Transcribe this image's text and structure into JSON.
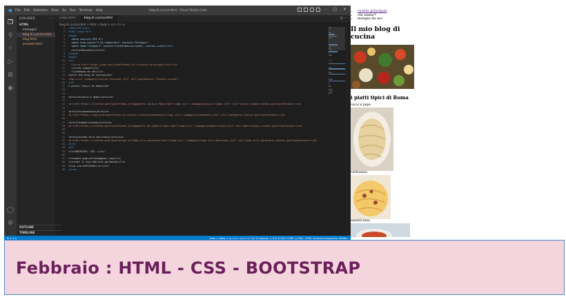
{
  "vscode": {
    "menu": [
      "File",
      "Edit",
      "Selection",
      "View",
      "Go",
      "Run",
      "Terminal",
      "Help"
    ],
    "window_title": "blog di cucina.html - Visual Studio Code",
    "explorer": {
      "header": "EXPLORER",
      "section": "HTML",
      "files": [
        "immagini",
        "blog di cucina.html",
        "blog.html",
        "prodotti.html"
      ],
      "outline": "OUTLINE",
      "timeline": "TIMELINE"
    },
    "tabs": [
      "index.html",
      "blog di cucina.html"
    ],
    "breadcrumb": "blog di cucina.html > html > body > ul > li > a",
    "lines": [
      {
        "n": "1",
        "t": "<!DOCTYPE html>",
        "c": "t"
      },
      {
        "n": "2",
        "t": "<html lang=\"en\">",
        "c": "t"
      },
      {
        "n": "3",
        "t": "<head>",
        "c": "t"
      },
      {
        "n": "4",
        "t": "  <meta charset=\"UTF-8\">",
        "c": "k"
      },
      {
        "n": "5",
        "t": "  <meta http-equiv=\"X-UA-Compatible\" content=\"IE=edge\">",
        "c": "k"
      },
      {
        "n": "6",
        "t": "  <meta name=\"viewport\" content=\"width=device-width, initial-scale=1.0\">",
        "c": "k"
      },
      {
        "n": "7",
        "t": "  <title>Document</title>",
        "c": ""
      },
      {
        "n": "8",
        "t": "</head>",
        "c": "t"
      },
      {
        "n": "9",
        "t": "<body>",
        "c": "t"
      },
      {
        "n": "10",
        "t": "<ul>",
        "c": "t"
      },
      {
        "n": "11",
        "t": "  <li><a href=\"https://www.giallozafferano.it/\">ricette principali</a></li>",
        "c": "s"
      },
      {
        "n": "12",
        "t": "  <li>chi siamo?</li>",
        "c": ""
      },
      {
        "n": "13",
        "t": "  <li>mangia da noi</li>",
        "c": ""
      },
      {
        "n": "14",
        "t": "<h2>Il mio blog di cucina</h2>",
        "c": ""
      },
      {
        "n": "15",
        "t": "<img src=\"./immagini/cucina italiana.jfif\" alt=\"ingredienti freschi cucina\">",
        "c": "s"
      },
      {
        "n": "16",
        "t": "<h3>",
        "c": "t"
      },
      {
        "n": "17",
        "t": "I piatti tipici di Roma</h3>",
        "c": ""
      },
      {
        "n": "18",
        "t": "",
        "c": ""
      },
      {
        "n": "19",
        "t": "",
        "c": ""
      },
      {
        "n": "20",
        "t": "<article>cacio e pepe</article>",
        "c": ""
      },
      {
        "n": "21",
        "t": "",
        "c": ""
      },
      {
        "n": "22",
        "t": "<a href=\"https://ricette.giallozafferano.it/Spaghetti-Cacio-e-Pepe.html\"><img src=\"./immagini/cacio e pepe.jfif\" alt=\"cacio e pepe,ricetta giallozafferano\"></a>",
        "c": "s"
      },
      {
        "n": "23",
        "t": "",
        "c": ""
      },
      {
        "n": "24",
        "t": "<article>carbonara</article>",
        "c": ""
      },
      {
        "n": "25",
        "t": "<a href=\"https://www.giallozafferano.it/ricerca-ricette/carbonara/\"><img src=\"./immagini/carbonara.jfif\" alt=\"carbonara,ricetta giallozafferano\"></a>",
        "c": "s"
      },
      {
        "n": "26",
        "t": "",
        "c": ""
      },
      {
        "n": "27",
        "t": "<article>amatriciana</article>",
        "c": ""
      },
      {
        "n": "28",
        "t": "<a href=\"https://ricette.giallozafferano.it/Spaghetti-all-Amatriciana.html\"><img src=\"./immagini/amatriciana.jfif\" alt=\"amatriciana,ricetta giallozafferano\"></a>",
        "c": "s"
      },
      {
        "n": "29",
        "t": "",
        "c": ""
      },
      {
        "n": "30",
        "t": "",
        "c": ""
      },
      {
        "n": "31",
        "t": "<article>coda alla vaccinara</article>",
        "c": ""
      },
      {
        "n": "32",
        "t": "<a href=\"https://ricette.giallozafferano.it/Coda-alla-vaccinara.html\"><img src=\"./immagini/coda alla vaccinara.jfif\" alt=\"coda alla vaccinara,ricetta giallozafferano\"></a>",
        "c": "s"
      },
      {
        "n": "33",
        "t": "<pre>",
        "c": "t"
      },
      {
        "n": "34",
        "t": "<ol>",
        "c": "t"
      },
      {
        "n": "35",
        "t": "<li>INDIRIZZO: VIA..</li>",
        "c": ""
      },
      {
        "n": "36",
        "t": "",
        "c": ""
      },
      {
        "n": "37",
        "t": "<li>email:gigliofreso@gmail.com</li>",
        "c": ""
      },
      {
        "n": "38",
        "t": "<li>chef il tuo:fabrizio garibaldi</li>",
        "c": ""
      },
      {
        "n": "39",
        "t": "<li>p.iva:23413456</li></ol>",
        "c": ""
      },
      {
        "n": "40",
        "t": "</pre>",
        "c": "t"
      }
    ],
    "status_left": "⊗ 0 ⚠ 0",
    "status_right": "html > body > ul > li > a   Ln 11, Col 70   Spaces: 2   UTF-8   CRLF   HTML   ◎ Port : 5500   Controllo ortografico   Prettier"
  },
  "preview": {
    "menu": [
      "ricette principali",
      "chi siamo?",
      "mangia da noi"
    ],
    "title": "Il mio blog di cucina",
    "subtitle": "i piatti tipici di Roma",
    "dishes": [
      "cacio e pepe",
      "carbonara",
      "amatriciana"
    ]
  },
  "banner": {
    "text": "Febbraio :  HTML - CSS - BOOTSTRAP"
  },
  "colors": {
    "vscode_bg": "#1e1e1e",
    "statusbar": "#007acc",
    "banner_bg": "#f4d5dd",
    "banner_text": "#6b1f5a"
  }
}
